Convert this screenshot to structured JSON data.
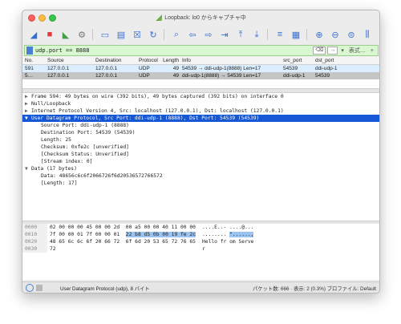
{
  "window": {
    "title": "Loopback: lo0 からキャプチャ中"
  },
  "toolbar": {
    "icons": [
      "shark-fin-start-icon",
      "stop-square-icon",
      "restart-fin-icon",
      "options-gear-icon",
      "open-folder-icon",
      "save-file-icon",
      "close-file-icon",
      "reload-icon",
      "find-magnifier-icon",
      "back-arrow-icon",
      "forward-arrow-icon",
      "go-to-packet-icon",
      "first-packet-icon",
      "last-packet-icon",
      "autoscroll-icon",
      "colorize-icon",
      "zoom-in-icon",
      "zoom-out-icon",
      "normal-size-icon",
      "resize-columns-icon"
    ]
  },
  "filter": {
    "value": "udp.port == 8888",
    "clear": "⌫",
    "arrow": "→",
    "dropdown": "▾",
    "expression": "表式…",
    "add": "+"
  },
  "packet_list": {
    "headers": [
      "No.",
      "Source",
      "Destination",
      "Protocol",
      "Length",
      "Info",
      "src_port",
      "dst_port"
    ],
    "rows": [
      {
        "no": "591",
        "src": "127.0.0.1",
        "dst": "127.0.0.1",
        "proto": "UDP",
        "len": "49",
        "info": "54539 → ddi-udp-1(8888) Len=17",
        "sport": "54539",
        "dport": "ddi-udp-1"
      },
      {
        "no": "5…",
        "src": "127.0.0.1",
        "dst": "127.0.0.1",
        "proto": "UDP",
        "len": "49",
        "info": "ddi-udp-1(8888) → 54539 Len=17",
        "sport": "ddi-udp-1",
        "dport": "54539"
      }
    ]
  },
  "details": [
    {
      "tri": "▶",
      "text": "Frame 594: 49 bytes on wire (392 bits), 49 bytes captured (392 bits) on interface 0",
      "sel": false,
      "indent": 0
    },
    {
      "tri": "▶",
      "text": "Null/Loopback",
      "sel": false,
      "indent": 0
    },
    {
      "tri": "▶",
      "text": "Internet Protocol Version 4, Src: localhost (127.0.0.1), Dst: localhost (127.0.0.1)",
      "sel": false,
      "indent": 0
    },
    {
      "tri": "▼",
      "text": "User Datagram Protocol, Src Port: ddi-udp-1 (8888), Dst Port: 54539 (54539)",
      "sel": true,
      "indent": 0
    },
    {
      "tri": "",
      "text": "Source Port: ddi-udp-1 (8888)",
      "sel": false,
      "indent": 1
    },
    {
      "tri": "",
      "text": "Destination Port: 54539 (54539)",
      "sel": false,
      "indent": 1
    },
    {
      "tri": "",
      "text": "Length: 25",
      "sel": false,
      "indent": 1
    },
    {
      "tri": "",
      "text": "Checksum: 0xfe2c [unverified]",
      "sel": false,
      "indent": 1
    },
    {
      "tri": "",
      "text": "[Checksum Status: Unverified]",
      "sel": false,
      "indent": 1
    },
    {
      "tri": "",
      "text": "[Stream index: 0]",
      "sel": false,
      "indent": 1
    },
    {
      "tri": "▼",
      "text": "Data (17 bytes)",
      "sel": false,
      "indent": 0
    },
    {
      "tri": "",
      "text": "Data: 48656c6c6f2066726f6d20536572766572",
      "sel": false,
      "indent": 1
    },
    {
      "tri": "",
      "text": "[Length: 17]",
      "sel": false,
      "indent": 1
    }
  ],
  "bytes": [
    {
      "off": "0000",
      "hex_a": "02 00 00 00 45 00 00 2d  00 a5 00 00 40 11 00 00",
      "hex_hl": "",
      "hex_b": "",
      "asc_a": "....E..- ....@...",
      "asc_hl": "",
      "asc_b": ""
    },
    {
      "off": "0010",
      "hex_a": "7f 00 00 01 7f 00 00 01  ",
      "hex_hl": "22 b8 d5 0b 00 19 fe 2c",
      "hex_b": "",
      "asc_a": "........ ",
      "asc_hl": "\"......,",
      "asc_b": ""
    },
    {
      "off": "0020",
      "hex_a": "48 65 6c 6c 6f 20 66 72  6f 6d 20 53 65 72 76 65",
      "hex_hl": "",
      "hex_b": "",
      "asc_a": "Hello fr om Serve",
      "asc_hl": "",
      "asc_b": ""
    },
    {
      "off": "0030",
      "hex_a": "72",
      "hex_hl": "",
      "hex_b": "",
      "asc_a": "r",
      "asc_hl": "",
      "asc_b": ""
    }
  ],
  "status": {
    "left": "User Datagram Protocol (udp), 8 バイト",
    "right": "パケット数: 666 · 表示: 2 (0.3%)   プロファイル: Default"
  }
}
